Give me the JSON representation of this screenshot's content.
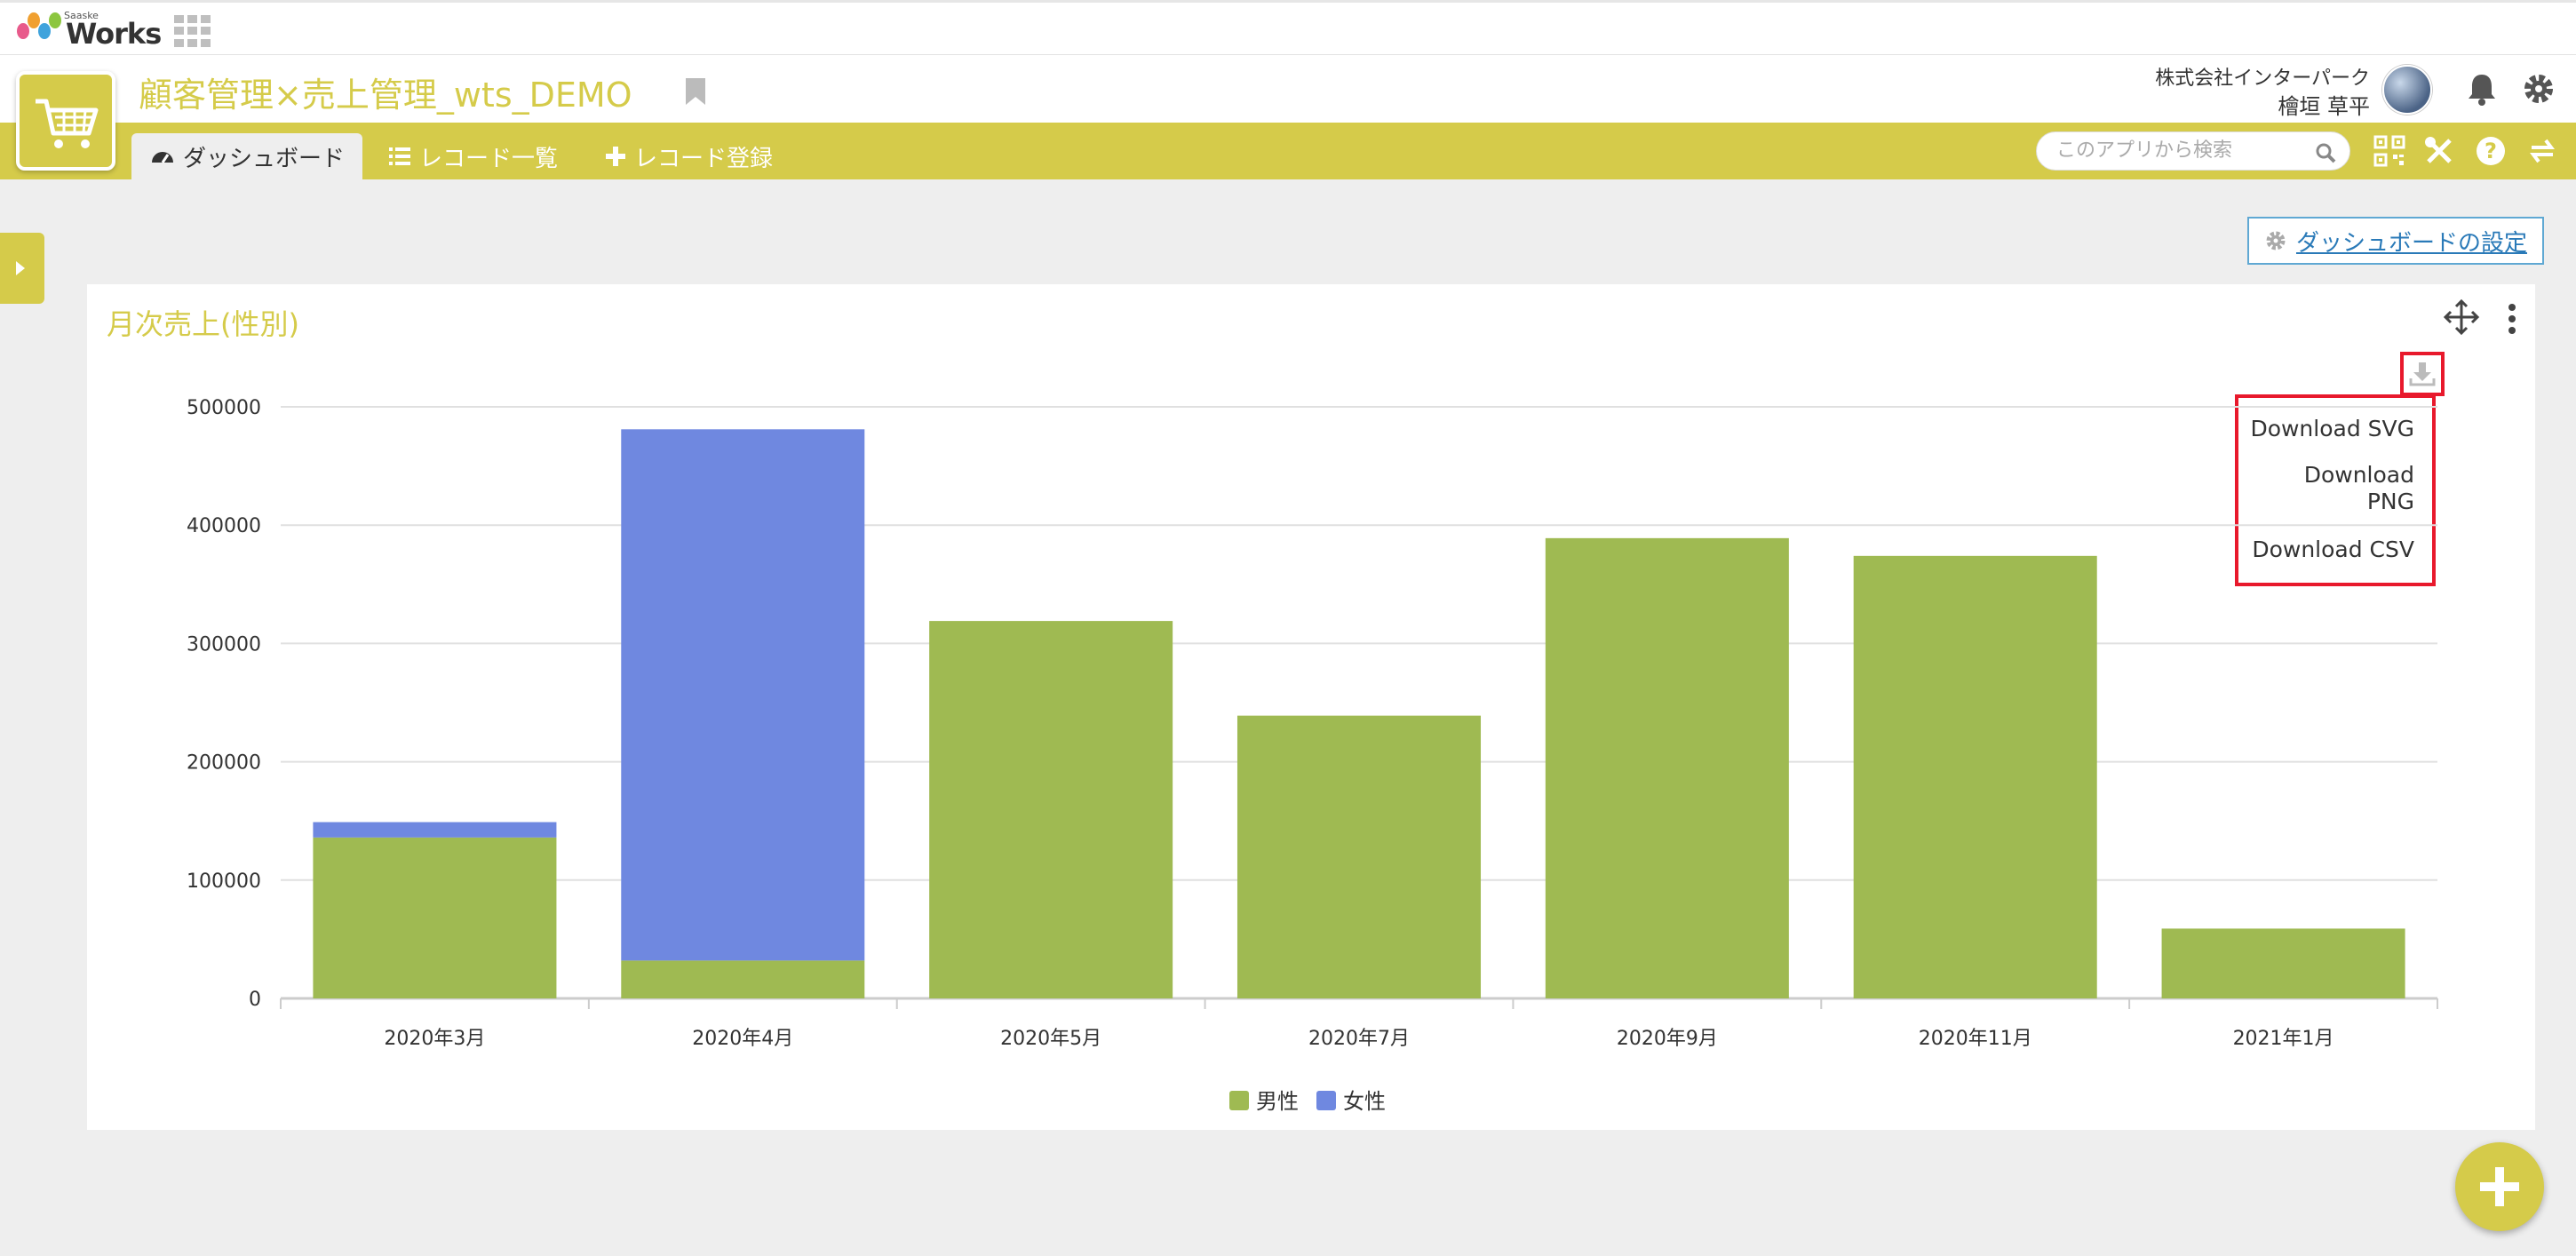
{
  "topbar": {
    "brand_small": "Saaske",
    "brand": "Works"
  },
  "app": {
    "title": "顧客管理×売上管理_wts_DEMO"
  },
  "user": {
    "company": "株式会社インターパーク",
    "name": "檜垣 草平"
  },
  "nav": {
    "tabs": [
      {
        "label": "ダッシュボード"
      },
      {
        "label": "レコード一覧"
      },
      {
        "label": "レコード登録"
      }
    ],
    "search_placeholder": "このアプリから検索"
  },
  "dashboard": {
    "settings_label": "ダッシュボードの設定"
  },
  "widget": {
    "title": "月次売上(性別)",
    "download_menu": [
      "Download SVG",
      "Download PNG",
      "Download CSV"
    ]
  },
  "colors": {
    "accent": "#d5cb4a",
    "male": "#9fba52",
    "female": "#6f88e0"
  },
  "chart_data": {
    "type": "bar",
    "stacked": true,
    "categories": [
      "2020年3月",
      "2020年4月",
      "2020年5月",
      "2020年7月",
      "2020年9月",
      "2020年11月",
      "2021年1月"
    ],
    "series": [
      {
        "name": "男性",
        "values": [
          136000,
          32000,
          319000,
          239000,
          389000,
          374000,
          59000
        ]
      },
      {
        "name": "女性",
        "values": [
          13000,
          449000,
          0,
          0,
          0,
          0,
          0
        ]
      }
    ],
    "ylim": [
      0,
      500000
    ],
    "yticks": [
      0,
      100000,
      200000,
      300000,
      400000,
      500000
    ],
    "grid": true,
    "legend": "bottom-center"
  }
}
